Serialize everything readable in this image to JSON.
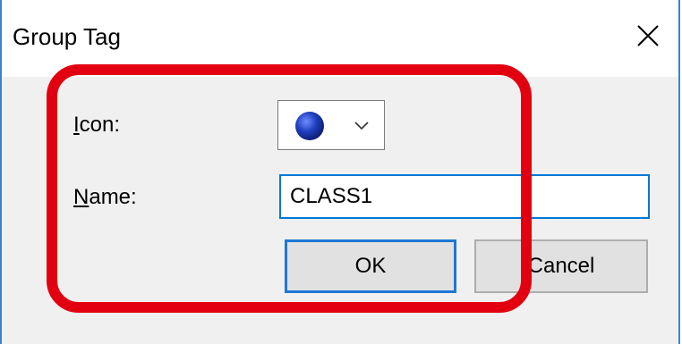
{
  "window": {
    "title": "Group Tag",
    "close_icon": "close-icon"
  },
  "form": {
    "icon_label": "Icon:",
    "icon_label_accel": "I",
    "icon_label_rest": "con:",
    "icon_value": "blue-ball-icon",
    "name_label_accel": "N",
    "name_label_rest": "ame:",
    "name_value": "CLASS1"
  },
  "buttons": {
    "ok_label": "OK",
    "cancel_label": "Cancel"
  },
  "colors": {
    "accent": "#0078d7",
    "highlight": "#e20010",
    "icon_ball": "#1f3fbf"
  }
}
